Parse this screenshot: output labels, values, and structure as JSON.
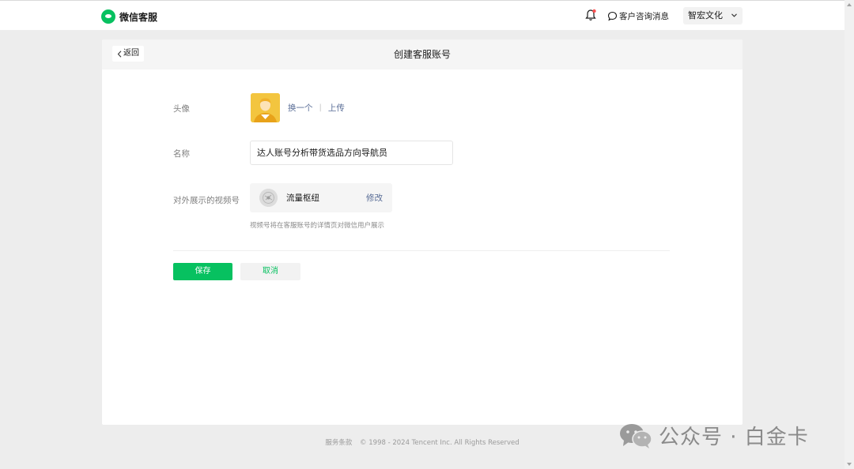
{
  "topbar": {
    "brand": "微信客服",
    "messages_label": "客户咨询消息",
    "account_name": "智宏文化"
  },
  "card": {
    "back_label": "返回",
    "title": "创建客服账号"
  },
  "form": {
    "avatar_label": "头像",
    "avatar_change": "换一个",
    "avatar_separator": "|",
    "avatar_upload": "上传",
    "name_label": "名称",
    "name_value": "达人账号分析带货选品方向导航员",
    "channel_label": "对外展示的视频号",
    "channel_name": "流量枢纽",
    "channel_edit": "修改",
    "channel_hint": "视频号将在客服账号的详情页对微信用户展示",
    "save_label": "保存",
    "cancel_label": "取消"
  },
  "footer": {
    "terms": "服务条款",
    "copyright": "© 1998 - 2024 Tencent Inc. All Rights Reserved"
  },
  "watermark": {
    "text": "公众号 · 白金卡"
  },
  "colors": {
    "accent": "#07c160",
    "link": "#576b95",
    "notification_dot": "#fa5151"
  }
}
